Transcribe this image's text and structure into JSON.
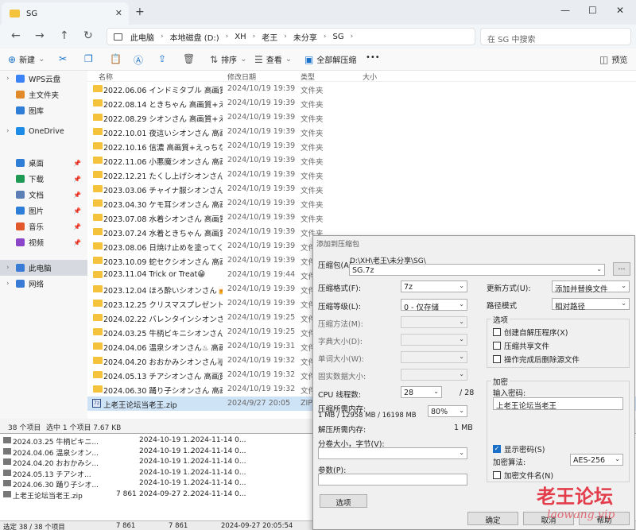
{
  "window": {
    "tab_title": "SG",
    "new_tab": "+",
    "close": "✕",
    "minimize": "—",
    "maximize": "☐",
    "win_close": "✕"
  },
  "nav": {
    "back": "←",
    "forward": "→",
    "up": "↑",
    "refresh": "↻",
    "breadcrumbs": [
      "此电脑",
      "本地磁盘 (D:)",
      "XH",
      "老王",
      "未分享",
      "SG"
    ],
    "search_placeholder": "在 SG 中搜索"
  },
  "toolbar": {
    "new": "新建",
    "sort": "排序",
    "view": "查看",
    "extract_all": "全部解压缩",
    "more": "•••",
    "preview": "预览"
  },
  "sidebar": {
    "items": [
      {
        "label": "WPS云盘",
        "chev": "›",
        "pinned": false,
        "color": "#3b82f6"
      },
      {
        "label": "主文件夹",
        "chev": "",
        "pinned": false,
        "color": "#e08a2b"
      },
      {
        "label": "图库",
        "chev": "",
        "pinned": false,
        "color": "#2e7dd7"
      },
      {
        "label": "OneDrive",
        "chev": "›",
        "pinned": false,
        "color": "#1c8ce6"
      },
      {
        "label": "桌面",
        "chev": "",
        "pinned": true,
        "color": "#2e7dd7"
      },
      {
        "label": "下载",
        "chev": "",
        "pinned": true,
        "color": "#1f9a55"
      },
      {
        "label": "文档",
        "chev": "",
        "pinned": true,
        "color": "#5b7fb5"
      },
      {
        "label": "图片",
        "chev": "",
        "pinned": true,
        "color": "#2e7dd7"
      },
      {
        "label": "音乐",
        "chev": "",
        "pinned": true,
        "color": "#e2572b"
      },
      {
        "label": "视频",
        "chev": "",
        "pinned": true,
        "color": "#8b45c8"
      },
      {
        "label": "此电脑",
        "chev": "›",
        "pinned": false,
        "color": "#3a7bd5"
      },
      {
        "label": "网络",
        "chev": "›",
        "pinned": false,
        "color": "#3a7bd5"
      }
    ],
    "pin_glyph": "📌"
  },
  "columns": {
    "name": "名称",
    "date": "修改日期",
    "type": "类型",
    "size": "大小"
  },
  "files": [
    {
      "name": "2022.06.06 インドミタブル 高画質+R...",
      "date": "2024/10/19 19:39",
      "type": "文件夹"
    },
    {
      "name": "2022.08.14 ときちゃん 高画質+えっち...",
      "date": "2024/10/19 19:39",
      "type": "文件夹"
    },
    {
      "name": "2022.08.29 シオンさん 高画質+えっち...",
      "date": "2024/10/19 19:39",
      "type": "文件夹"
    },
    {
      "name": "2022.10.01 夜這いシオンさん 高画質...",
      "date": "2024/10/19 19:39",
      "type": "文件夹"
    },
    {
      "name": "2022.10.16 信濃 高画質+えっちな差分",
      "date": "2024/10/19 19:39",
      "type": "文件夹"
    },
    {
      "name": "2022.11.06 小悪魔シオンさん 高画質+...",
      "date": "2024/10/19 19:39",
      "type": "文件夹"
    },
    {
      "name": "2022.12.21 たくし上げシオンさん 高...",
      "date": "2024/10/19 19:39",
      "type": "文件夹"
    },
    {
      "name": "2023.03.06 チャイナ服シオンさん 高画...",
      "date": "2024/10/19 19:39",
      "type": "文件夹"
    },
    {
      "name": "2023.04.30 ケモ耳シオンさん 高画質...",
      "date": "2024/10/19 19:39",
      "type": "文件夹"
    },
    {
      "name": "2023.07.08 水着シオンさん 高画質+え...",
      "date": "2024/10/19 19:39",
      "type": "文件夹"
    },
    {
      "name": "2023.07.24 水着ときちゃん 高画質+え...",
      "date": "2024/10/19 19:39",
      "type": "文件夹"
    },
    {
      "name": "2023.08.06 日焼け止めを塗ってくれる...",
      "date": "2024/10/19 19:39",
      "type": "文件夹"
    },
    {
      "name": "2023.10.09 蛇セクシオンさん 高画質+...",
      "date": "2024/10/19 19:39",
      "type": "文件夹"
    },
    {
      "name": "2023.11.04 Trick or Treat😁",
      "date": "2024/10/19 19:44",
      "type": "文件夹"
    },
    {
      "name": "2023.12.04 ほろ酔いシオンさん🍺 高...",
      "date": "2024/10/19 19:39",
      "type": "文件夹"
    },
    {
      "name": "2023.12.25 クリスマスプレゼント🎁",
      "date": "2024/10/19 19:39",
      "type": "文件夹"
    },
    {
      "name": "2024.02.22 バレンタインシオンさん🍫...",
      "date": "2024/10/19 19:25",
      "type": "文件夹"
    },
    {
      "name": "2024.03.25 牛柄ビキニシオンさん🐮...",
      "date": "2024/10/19 19:25",
      "type": "文件夹"
    },
    {
      "name": "2024.04.06 温泉シオンさん♨ 高画質...",
      "date": "2024/10/19 19:31",
      "type": "文件夹"
    },
    {
      "name": "2024.04.20 おおかみシオンさん🐺 +差分",
      "date": "2024/10/19 19:32",
      "type": "文件夹"
    },
    {
      "name": "2024.05.13 チアシオンさん 高画質+え...",
      "date": "2024/10/19 19:32",
      "type": "文件夹"
    },
    {
      "name": "2024.06.30 踊り子シオンさん 高画質+...",
      "date": "2024/10/19 19:32",
      "type": "文件夹"
    },
    {
      "name": "上老王论坛当老王.zip",
      "date": "2024/9/27 20:05",
      "type": "ZIP",
      "selected": true,
      "zip": true
    }
  ],
  "status": {
    "count": "38 个项目",
    "selection": "选中 1 个项目  7.67 KB"
  },
  "behind": {
    "rows": [
      {
        "name": "2024.03.25 牛柄ビキニ...",
        "size": "",
        "modified": "2024-10-19 1...",
        "created": "2024-11-14 0..."
      },
      {
        "name": "2024.04.06 温泉シオン...",
        "size": "",
        "modified": "2024-10-19 1...",
        "created": "2024-11-14 0..."
      },
      {
        "name": "2024.04.20 おおかみシ...",
        "size": "",
        "modified": "2024-10-19 1...",
        "created": "2024-11-14 0..."
      },
      {
        "name": "2024.05.13 チアシオ...",
        "size": "",
        "modified": "2024-10-19 1...",
        "created": "2024-11-14 0..."
      },
      {
        "name": "2024.06.30 踊り子シオ...",
        "size": "",
        "modified": "2024-10-19 1...",
        "created": "2024-11-14 0..."
      },
      {
        "name": "上老王论坛当老王.zip",
        "size": "7 861",
        "modified": "2024-09-27 2...",
        "created": "2024-11-14 0..."
      }
    ],
    "status_left": "选定 38 / 38 个项目",
    "status_size1": "7 861",
    "status_size2": "7 861",
    "status_date": "2024-09-27 20:05:54"
  },
  "dialog": {
    "title": "添加到压缩包",
    "archive_label": "压缩包(A):",
    "archive_path": "D:\\XH\\老王\\未分享\\SG\\",
    "archive_name": "SG.7z",
    "browse": "...",
    "format_label": "压缩格式(F):",
    "format_value": "7z",
    "level_label": "压缩等级(L):",
    "level_value": "0 - 仅存储",
    "method_label": "压缩方法(M):",
    "dict_label": "字典大小(D):",
    "word_label": "单词大小(W):",
    "solid_label": "固实数据大小:",
    "threads_label": "CPU 线程数:",
    "threads_value": "28",
    "threads_total": "/ 28",
    "mem_label": "压缩所需内存:",
    "mem_value": "1 MB / 12958 MB / 16198 MB",
    "mem_percent": "80%",
    "decomp_label": "解压所需内存:",
    "decomp_value": "1 MB",
    "split_label": "分卷大小，字节(V):",
    "params_label": "参数(P):",
    "options_btn": "选项",
    "update_label": "更新方式(U):",
    "update_value": "添加并替换文件",
    "path_label": "路径模式",
    "path_value": "相对路径",
    "options_group": "选项",
    "opt_sfx": "创建自解压程序(X)",
    "opt_shared": "压缩共享文件",
    "opt_delete": "操作完成后删除源文件",
    "enc_group": "加密",
    "pwd_label": "输入密码:",
    "pwd_value": "上老王论坛当老王",
    "show_pwd": "显示密码(S)",
    "enc_method_label": "加密算法:",
    "enc_method_value": "AES-256",
    "enc_names": "加密文件名(N)",
    "ok": "确定",
    "cancel": "取消",
    "help": "帮助"
  },
  "watermark": {
    "cn": "老王论坛",
    "en": "laowang.vip"
  }
}
